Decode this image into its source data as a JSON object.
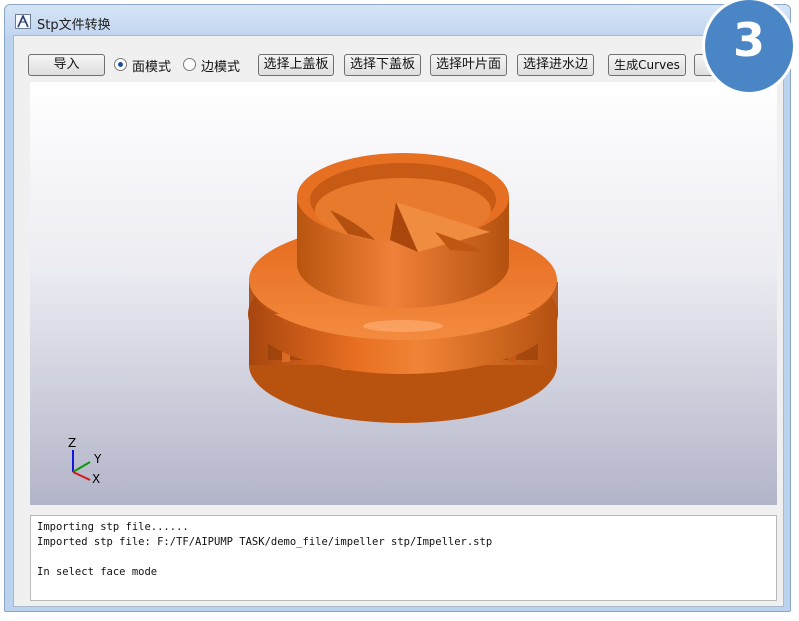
{
  "window": {
    "title": "Stp文件转换"
  },
  "toolbar": {
    "import_label": "导入",
    "face_mode_label": "面模式",
    "edge_mode_label": "边模式",
    "selected_mode": "face",
    "select_top_cover_label": "选择上盖板",
    "select_bottom_cover_label": "选择下盖板",
    "select_blade_label": "选择叶片面",
    "select_inlet_edge_label": "选择进水边",
    "generate_curves_label": "生成Curves"
  },
  "viewport": {
    "model_color": "#e0661c",
    "axes": {
      "z": "Z",
      "y": "Y",
      "x": "X"
    }
  },
  "console": {
    "lines": [
      "Importing stp file......",
      "Imported stp file: F:/TF/AIPUMP TASK/demo_file/impeller stp/Impeller.stp",
      "",
      "In select face mode"
    ]
  },
  "badge": {
    "number": "3",
    "color": "#4a86c5"
  }
}
